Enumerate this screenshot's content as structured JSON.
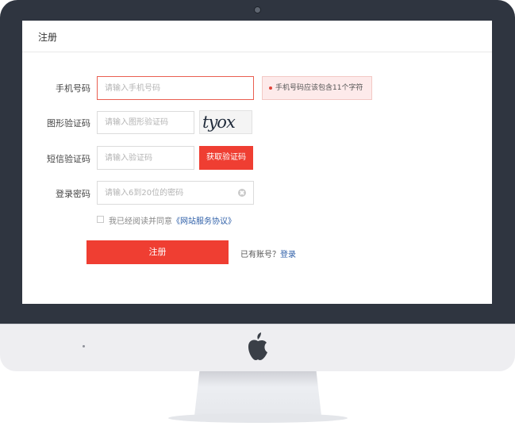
{
  "page": {
    "title": "注册"
  },
  "form": {
    "phone": {
      "label": "手机号码",
      "placeholder": "请输入手机号码",
      "value": ""
    },
    "phone_error": "手机号码应该包含11个字符",
    "captcha": {
      "label": "图形验证码",
      "placeholder": "请输入图形验证码",
      "value": "",
      "image_text": "tyox"
    },
    "sms": {
      "label": "短信验证码",
      "placeholder": "请输入验证码",
      "value": "",
      "button_label": "获取验证码"
    },
    "password": {
      "label": "登录密码",
      "placeholder": "请输入6到20位的密码",
      "value": ""
    },
    "agreement": {
      "checked": false,
      "text": "我已经阅读并同意",
      "link": "《网站服务协议》"
    },
    "submit_label": "注册",
    "login_prompt": "已有账号？",
    "login_link": "登录"
  },
  "colors": {
    "primary": "#ef3e32",
    "link": "#2e5fa8",
    "bezel": "#2f3540",
    "error_background": "#fdeaea"
  },
  "icons": [
    "apple-logo-icon",
    "clear-icon",
    "error-dot-icon"
  ]
}
